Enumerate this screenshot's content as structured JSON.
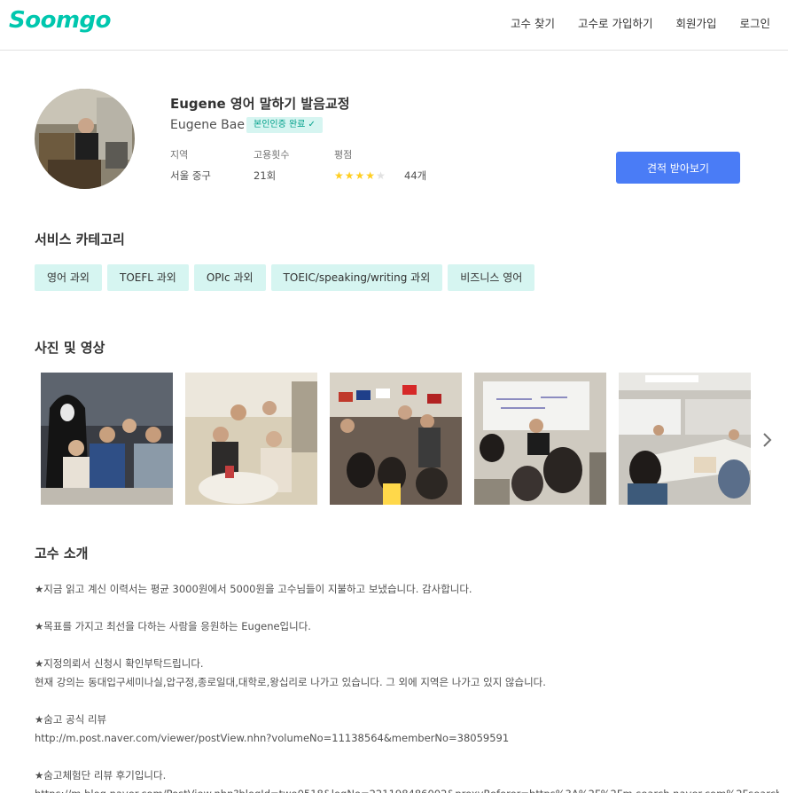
{
  "header": {
    "logo": "Soomgo",
    "nav": [
      "고수 찾기",
      "고수로 가입하기",
      "회원가입",
      "로그인"
    ]
  },
  "profile": {
    "title": "Eugene 영어 말하기 발음교정",
    "name": "Eugene Bae",
    "badge": "본인인증 완료 ✓",
    "stats": {
      "region_label": "지역",
      "region_value": "서울 중구",
      "hires_label": "고용횟수",
      "hires_value": "21회",
      "rating_label": "평점",
      "rating_stars": 4,
      "rating_max": 5,
      "review_count": "44개"
    },
    "quote_button": "견적 받아보기"
  },
  "categories": {
    "title": "서비스 카테고리",
    "items": [
      "영어 과외",
      "TOEFL 과외",
      "OPIc 과외",
      "TOEIC/speaking/writing 과외",
      "비즈니스 영어"
    ]
  },
  "media": {
    "title": "사진 및 영상"
  },
  "intro": {
    "title": "고수 소개",
    "lines": [
      "★지금 읽고 계신 이력서는 평균 3000원에서 5000원을 고수님들이 지불하고 보냈습니다. 감사합니다.",
      "",
      "★목표를 가지고 최선을 다하는 사람을 응원하는 Eugene입니다.",
      "",
      "★지정의뢰서 신청시 확인부탁드립니다.",
      "현재 강의는 동대입구세미나실,압구정,종로일대,대학로,왕십리로 나가고 있습니다. 그 외에 지역은 나가고 있지 않습니다.",
      "",
      "★숨고 공식 리뷰",
      "http://m.post.naver.com/viewer/postView.nhn?volumeNo=11138564&memberNo=38059591",
      "",
      "★숨고체험단 리뷰 후기입니다.",
      "https://m.blog.naver.com/PostView.nhn?blogId=two0518&logNo=221198486002&proxyReferer=https%3A%2F%2Fm.search.naver.com%2Fsearch.n"
    ]
  },
  "colors": {
    "brand": "#00c7ae",
    "button": "#4a7cf6",
    "chip_bg": "#d6f5f1",
    "star": "#ffce21"
  }
}
